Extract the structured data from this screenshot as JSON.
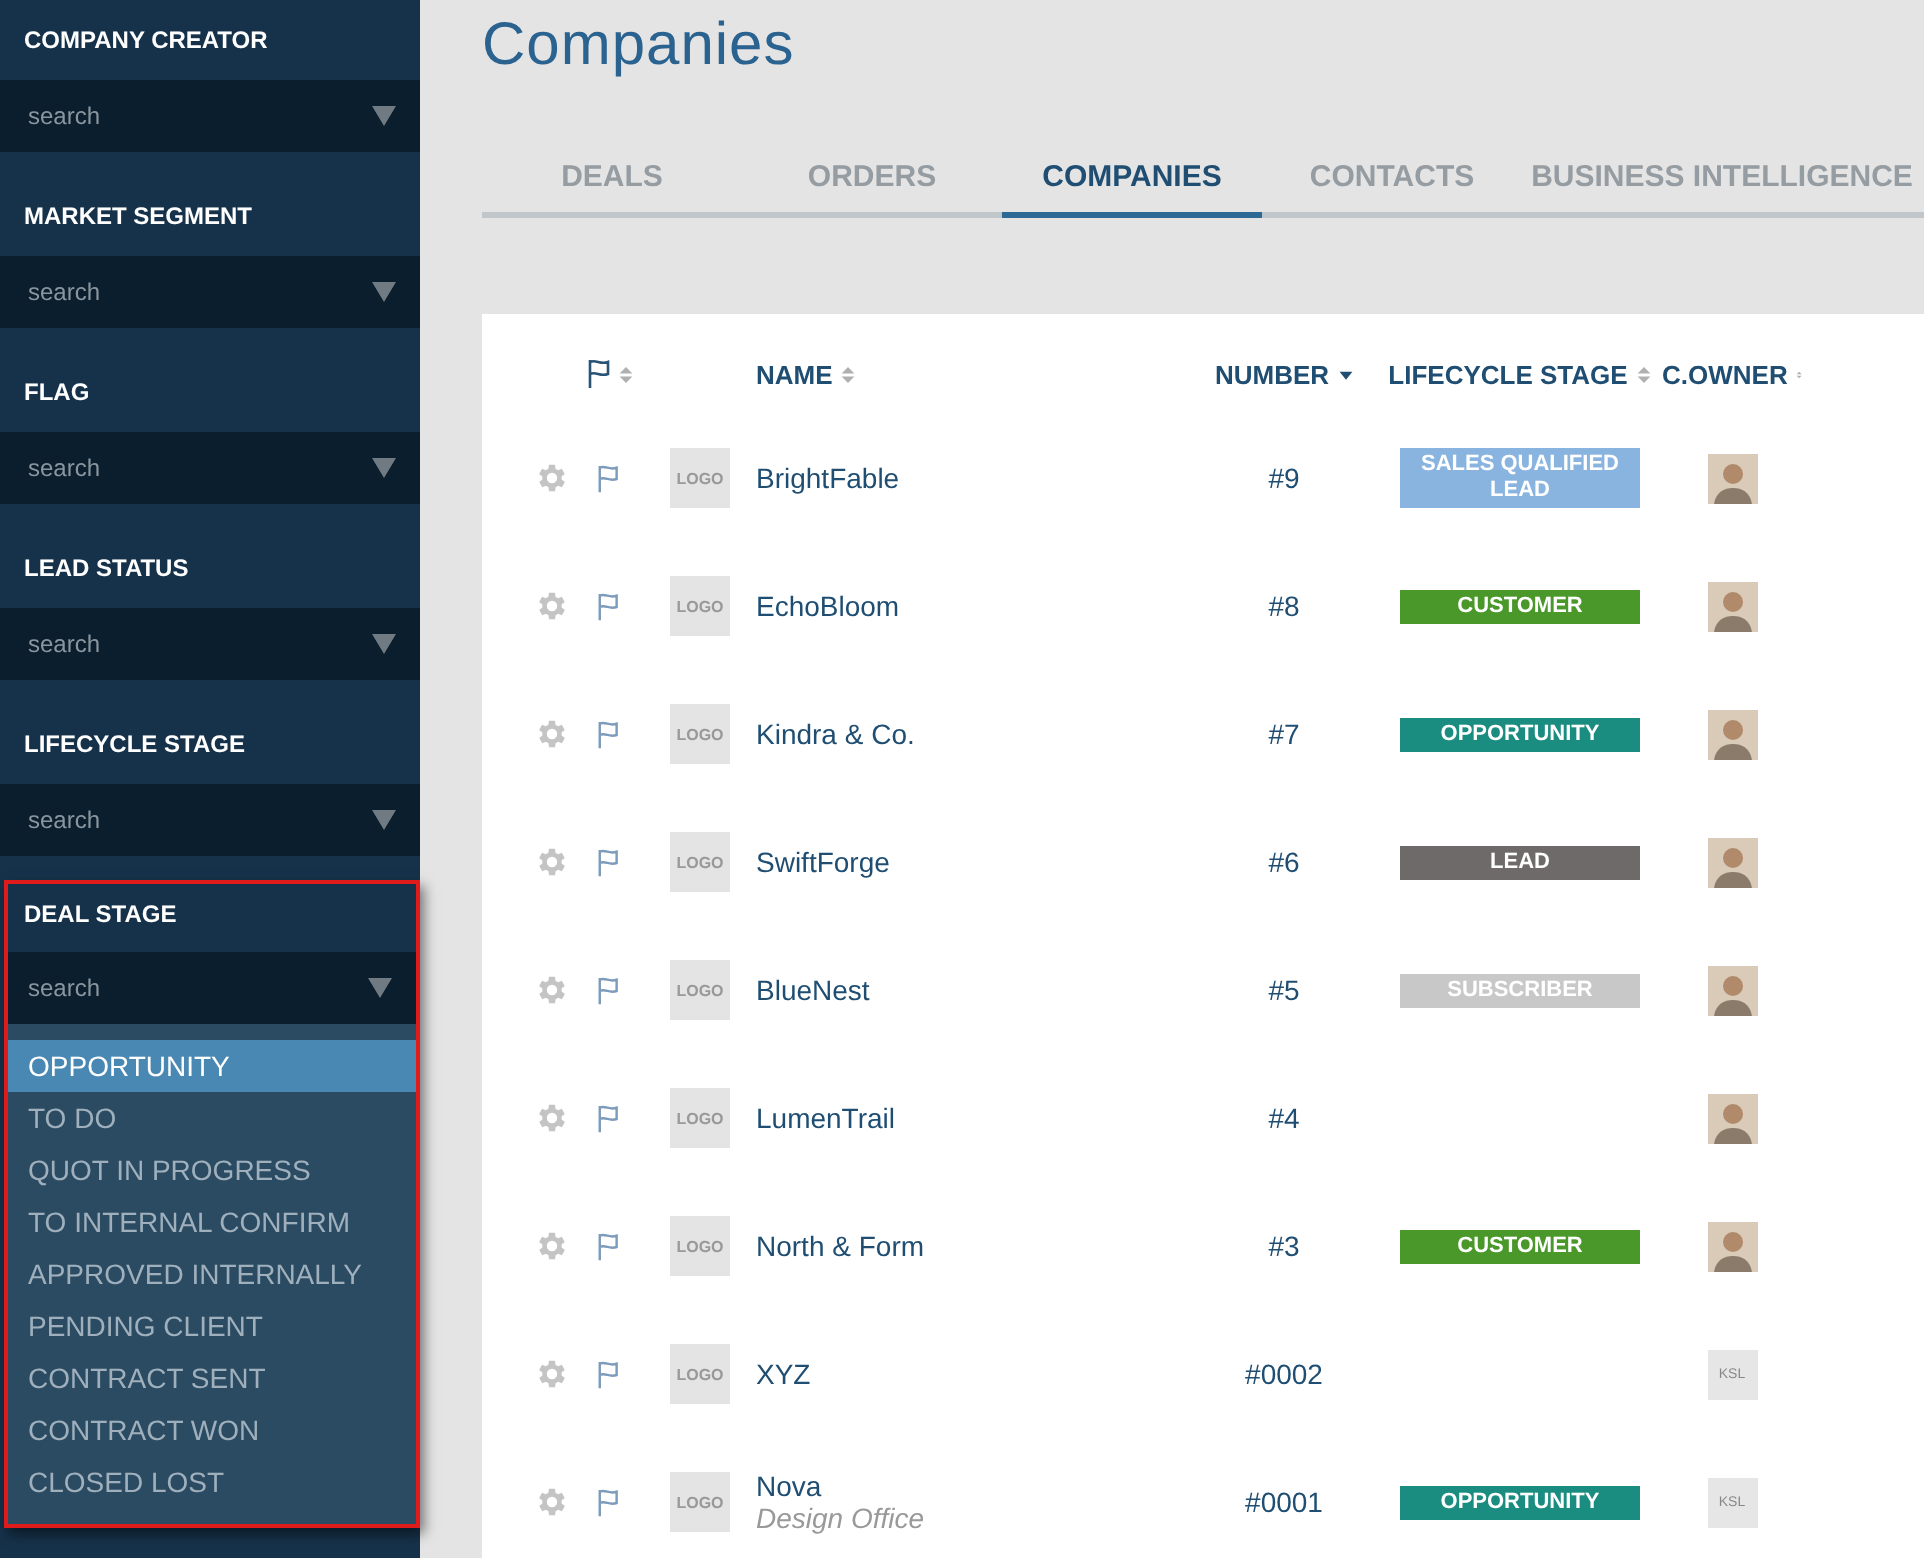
{
  "filters": [
    {
      "title": "COMPANY CREATOR",
      "placeholder": "search",
      "expanded": false,
      "highlighted": false
    },
    {
      "title": "MARKET SEGMENT",
      "placeholder": "search",
      "expanded": false,
      "highlighted": false
    },
    {
      "title": "FLAG",
      "placeholder": "search",
      "expanded": false,
      "highlighted": false
    },
    {
      "title": "LEAD STATUS",
      "placeholder": "search",
      "expanded": false,
      "highlighted": false
    },
    {
      "title": "LIFECYCLE STAGE",
      "placeholder": "search",
      "expanded": false,
      "highlighted": false
    },
    {
      "title": "DEAL STAGE",
      "placeholder": "search",
      "expanded": true,
      "highlighted": true,
      "options": [
        {
          "label": "OPPORTUNITY",
          "selected": true
        },
        {
          "label": "TO DO",
          "selected": false
        },
        {
          "label": "QUOT IN PROGRESS",
          "selected": false
        },
        {
          "label": "TO INTERNAL CONFIRM",
          "selected": false
        },
        {
          "label": "APPROVED INTERNALLY",
          "selected": false
        },
        {
          "label": "PENDING CLIENT",
          "selected": false
        },
        {
          "label": "CONTRACT SENT",
          "selected": false
        },
        {
          "label": "CONTRACT WON",
          "selected": false
        },
        {
          "label": "CLOSED LOST",
          "selected": false
        }
      ]
    }
  ],
  "page_title": "Companies",
  "tabs": [
    {
      "label": "DEALS",
      "selected": false
    },
    {
      "label": "ORDERS",
      "selected": false
    },
    {
      "label": "COMPANIES",
      "selected": true
    },
    {
      "label": "CONTACTS",
      "selected": false
    },
    {
      "label": "BUSINESS INTELLIGENCE",
      "selected": false
    }
  ],
  "table": {
    "columns": [
      {
        "kind": "flag",
        "sorted": false
      },
      {
        "kind": "name",
        "label": "NAME",
        "sorted": false
      },
      {
        "kind": "number",
        "label": "NUMBER",
        "sorted": true
      },
      {
        "kind": "stage",
        "label": "LIFECYCLE STAGE",
        "sorted": false
      },
      {
        "kind": "owner",
        "label": "C.OWNER",
        "sorted": false
      }
    ],
    "rows": [
      {
        "logo": "LOGO",
        "name": "BrightFable",
        "number": "#9",
        "stage": {
          "label": "SALES QUALIFIED LEAD",
          "color": "#8ab4e0"
        },
        "owner": {
          "kind": "avatar"
        }
      },
      {
        "logo": "LOGO",
        "name": "EchoBloom",
        "number": "#8",
        "stage": {
          "label": "CUSTOMER",
          "color": "#4a982a"
        },
        "owner": {
          "kind": "avatar"
        }
      },
      {
        "logo": "LOGO",
        "name": "Kindra & Co.",
        "number": "#7",
        "stage": {
          "label": "OPPORTUNITY",
          "color": "#1a8c80"
        },
        "owner": {
          "kind": "avatar"
        }
      },
      {
        "logo": "LOGO",
        "name": "SwiftForge",
        "number": "#6",
        "stage": {
          "label": "LEAD",
          "color": "#6f6a6a"
        },
        "owner": {
          "kind": "avatar"
        }
      },
      {
        "logo": "LOGO",
        "name": "BlueNest",
        "number": "#5",
        "stage": {
          "label": "SUBSCRIBER",
          "color": "#c8c8c8"
        },
        "owner": {
          "kind": "avatar"
        }
      },
      {
        "logo": "LOGO",
        "name": "LumenTrail",
        "number": "#4",
        "owner": {
          "kind": "avatar"
        }
      },
      {
        "logo": "LOGO",
        "name": "North & Form",
        "number": "#3",
        "stage": {
          "label": "CUSTOMER",
          "color": "#4a982a"
        },
        "owner": {
          "kind": "avatar"
        }
      },
      {
        "logo": "LOGO",
        "name": "XYZ",
        "number": "#0002",
        "owner": {
          "kind": "initials",
          "text": "KSL"
        }
      },
      {
        "logo": "LOGO",
        "name": "Nova",
        "subtitle": "Design Office",
        "number": "#0001",
        "stage": {
          "label": "OPPORTUNITY",
          "color": "#1a8c80"
        },
        "owner": {
          "kind": "initials",
          "text": "KSL"
        }
      }
    ]
  }
}
